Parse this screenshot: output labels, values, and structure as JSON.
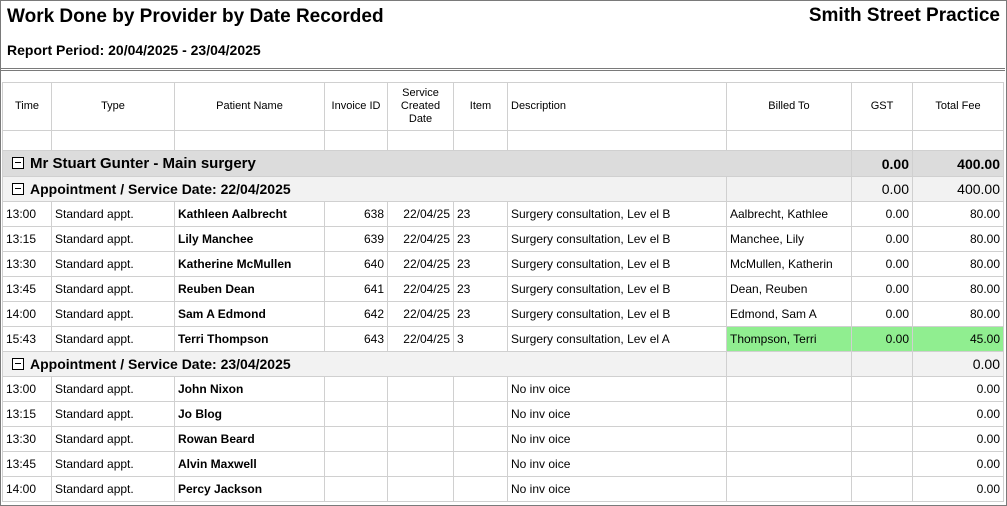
{
  "report": {
    "title": "Work Done by Provider by Date Recorded",
    "practice": "Smith Street Practice",
    "period": "Report Period: 20/04/2025 - 23/04/2025"
  },
  "columns": {
    "time": "Time",
    "type": "Type",
    "patient": "Patient Name",
    "invoice": "Invoice ID",
    "created": "Service Created Date",
    "item": "Item",
    "description": "Description",
    "billed": "Billed To",
    "gst": "GST",
    "total": "Total Fee"
  },
  "provider": {
    "name": "Mr Stuart Gunter - Main surgery",
    "gst": "0.00",
    "total": "400.00"
  },
  "groups": [
    {
      "label": "Appointment / Service Date: 22/04/2025",
      "gst": "0.00",
      "total": "400.00",
      "rows": [
        {
          "time": "13:00",
          "type": "Standard appt.",
          "patient": "Kathleen Aalbrecht",
          "invoice": "638",
          "created": "22/04/25",
          "item": "23",
          "description": "Surgery  consultation, Lev el B",
          "billed": "Aalbrecht, Kathlee",
          "gst": "0.00",
          "total": "80.00"
        },
        {
          "time": "13:15",
          "type": "Standard appt.",
          "patient": "Lily Manchee",
          "invoice": "639",
          "created": "22/04/25",
          "item": "23",
          "description": "Surgery  consultation, Lev el B",
          "billed": "Manchee, Lily",
          "gst": "0.00",
          "total": "80.00"
        },
        {
          "time": "13:30",
          "type": "Standard appt.",
          "patient": "Katherine McMullen",
          "invoice": "640",
          "created": "22/04/25",
          "item": "23",
          "description": "Surgery  consultation, Lev el B",
          "billed": "McMullen, Katherin",
          "gst": "0.00",
          "total": "80.00"
        },
        {
          "time": "13:45",
          "type": "Standard appt.",
          "patient": "Reuben Dean",
          "invoice": "641",
          "created": "22/04/25",
          "item": "23",
          "description": "Surgery  consultation, Lev el B",
          "billed": "Dean, Reuben",
          "gst": "0.00",
          "total": "80.00"
        },
        {
          "time": "14:00",
          "type": "Standard appt.",
          "patient": "Sam A Edmond",
          "invoice": "642",
          "created": "22/04/25",
          "item": "23",
          "description": "Surgery  consultation, Lev el B",
          "billed": "Edmond, Sam A",
          "gst": "0.00",
          "total": "80.00"
        },
        {
          "time": "15:43",
          "type": "Standard appt.",
          "patient": "Terri Thompson",
          "invoice": "643",
          "created": "22/04/25",
          "item": "3",
          "description": "Surgery  consultation, Lev el A",
          "billed": "Thompson, Terri",
          "gst": "0.00",
          "total": "45.00"
        }
      ]
    },
    {
      "label": "Appointment / Service Date: 23/04/2025",
      "gst": "",
      "total": "0.00",
      "rows": [
        {
          "time": "13:00",
          "type": "Standard appt.",
          "patient": "John Nixon",
          "invoice": "",
          "created": "",
          "item": "",
          "description": "No inv oice",
          "billed": "",
          "gst": "",
          "total": "0.00"
        },
        {
          "time": "13:15",
          "type": "Standard appt.",
          "patient": "Jo Blog",
          "invoice": "",
          "created": "",
          "item": "",
          "description": "No inv oice",
          "billed": "",
          "gst": "",
          "total": "0.00"
        },
        {
          "time": "13:30",
          "type": "Standard appt.",
          "patient": "Rowan Beard",
          "invoice": "",
          "created": "",
          "item": "",
          "description": "No inv oice",
          "billed": "",
          "gst": "",
          "total": "0.00"
        },
        {
          "time": "13:45",
          "type": "Standard appt.",
          "patient": "Alvin Maxwell",
          "invoice": "",
          "created": "",
          "item": "",
          "description": "No inv oice",
          "billed": "",
          "gst": "",
          "total": "0.00"
        },
        {
          "time": "14:00",
          "type": "Standard appt.",
          "patient": "Percy Jackson",
          "invoice": "",
          "created": "",
          "item": "",
          "description": "No inv oice",
          "billed": "",
          "gst": "",
          "total": "0.00"
        }
      ]
    }
  ],
  "highlight_color": "#90ee90"
}
